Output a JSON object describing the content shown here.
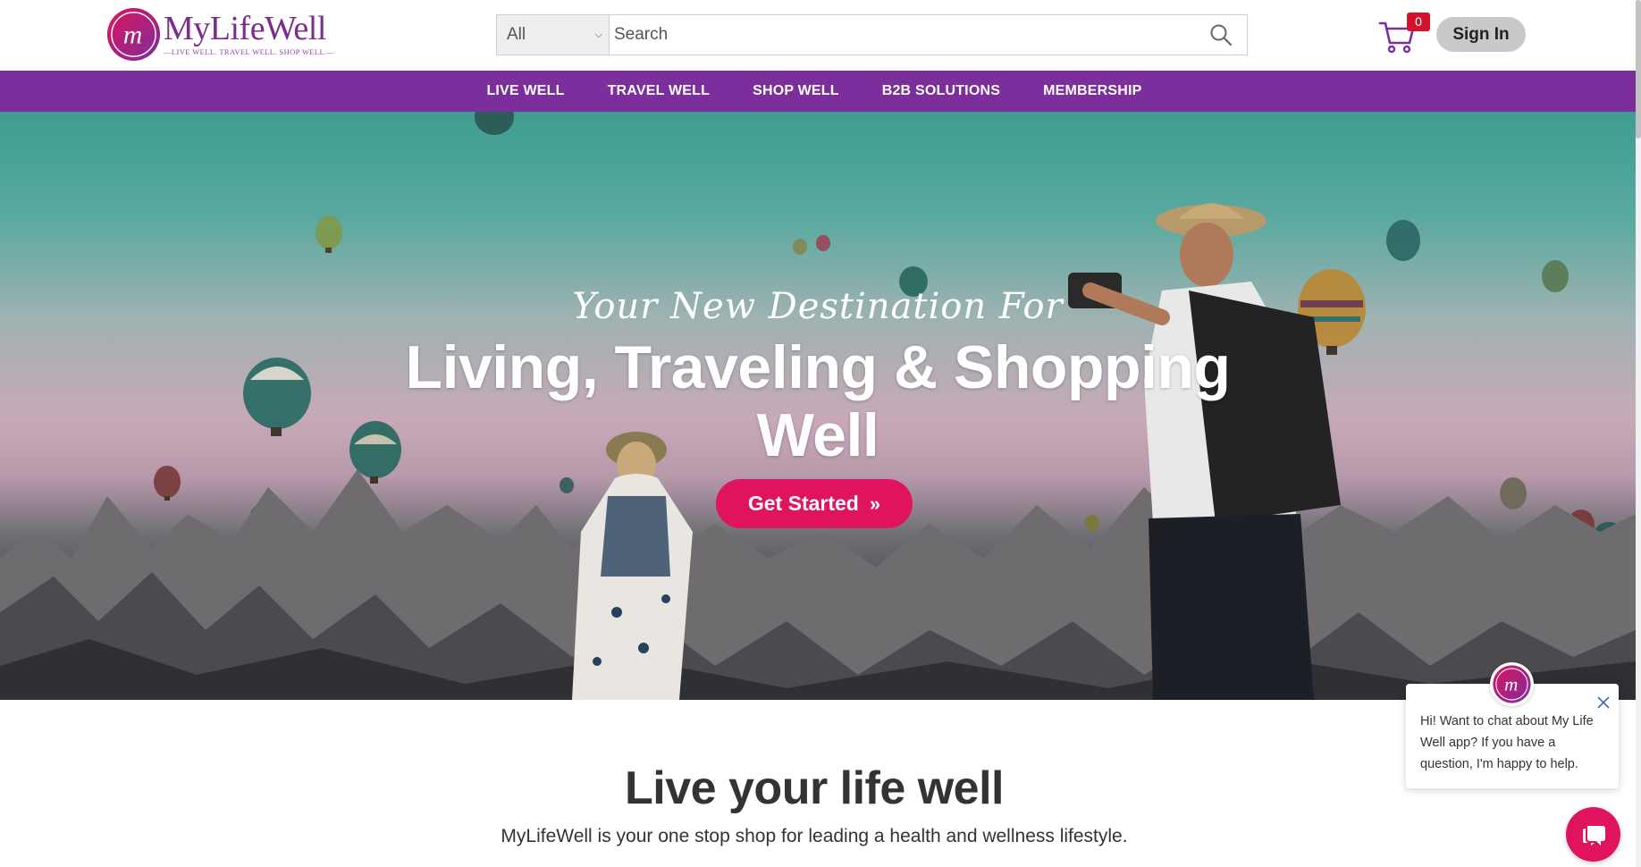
{
  "brand": {
    "name": "MyLifeWell",
    "tagline": "—LIVE WELL. TRAVEL WELL. SHOP WELL.—",
    "mark": "m",
    "colors": {
      "purple": "#7c2e9c",
      "pink": "#e0135e",
      "badge_red": "#d2132e"
    }
  },
  "search": {
    "category": "All",
    "placeholder": "Search",
    "icon": "search-icon"
  },
  "cart": {
    "count": "0",
    "icon": "shopping-cart-icon"
  },
  "auth": {
    "signin_label": "Sign In"
  },
  "nav": {
    "items": [
      {
        "label": "LIVE WELL"
      },
      {
        "label": "TRAVEL WELL"
      },
      {
        "label": "SHOP WELL"
      },
      {
        "label": "B2B SOLUTIONS"
      },
      {
        "label": "MEMBERSHIP"
      }
    ]
  },
  "hero": {
    "subtitle": "Your New Destination For",
    "title_line1": "Living, Traveling & Shopping",
    "title_line2": "Well",
    "cta_label": "Get Started",
    "cta_icon": "double-chevron-right-icon"
  },
  "intro": {
    "heading": "Live your life well",
    "text": "MyLifeWell is your one stop shop for leading a health and wellness lifestyle."
  },
  "chat": {
    "message": "Hi! Want to chat about My Life Well app? If you have a question, I'm happy to help.",
    "close_icon": "close-icon",
    "launcher_icon": "chat-icon"
  }
}
